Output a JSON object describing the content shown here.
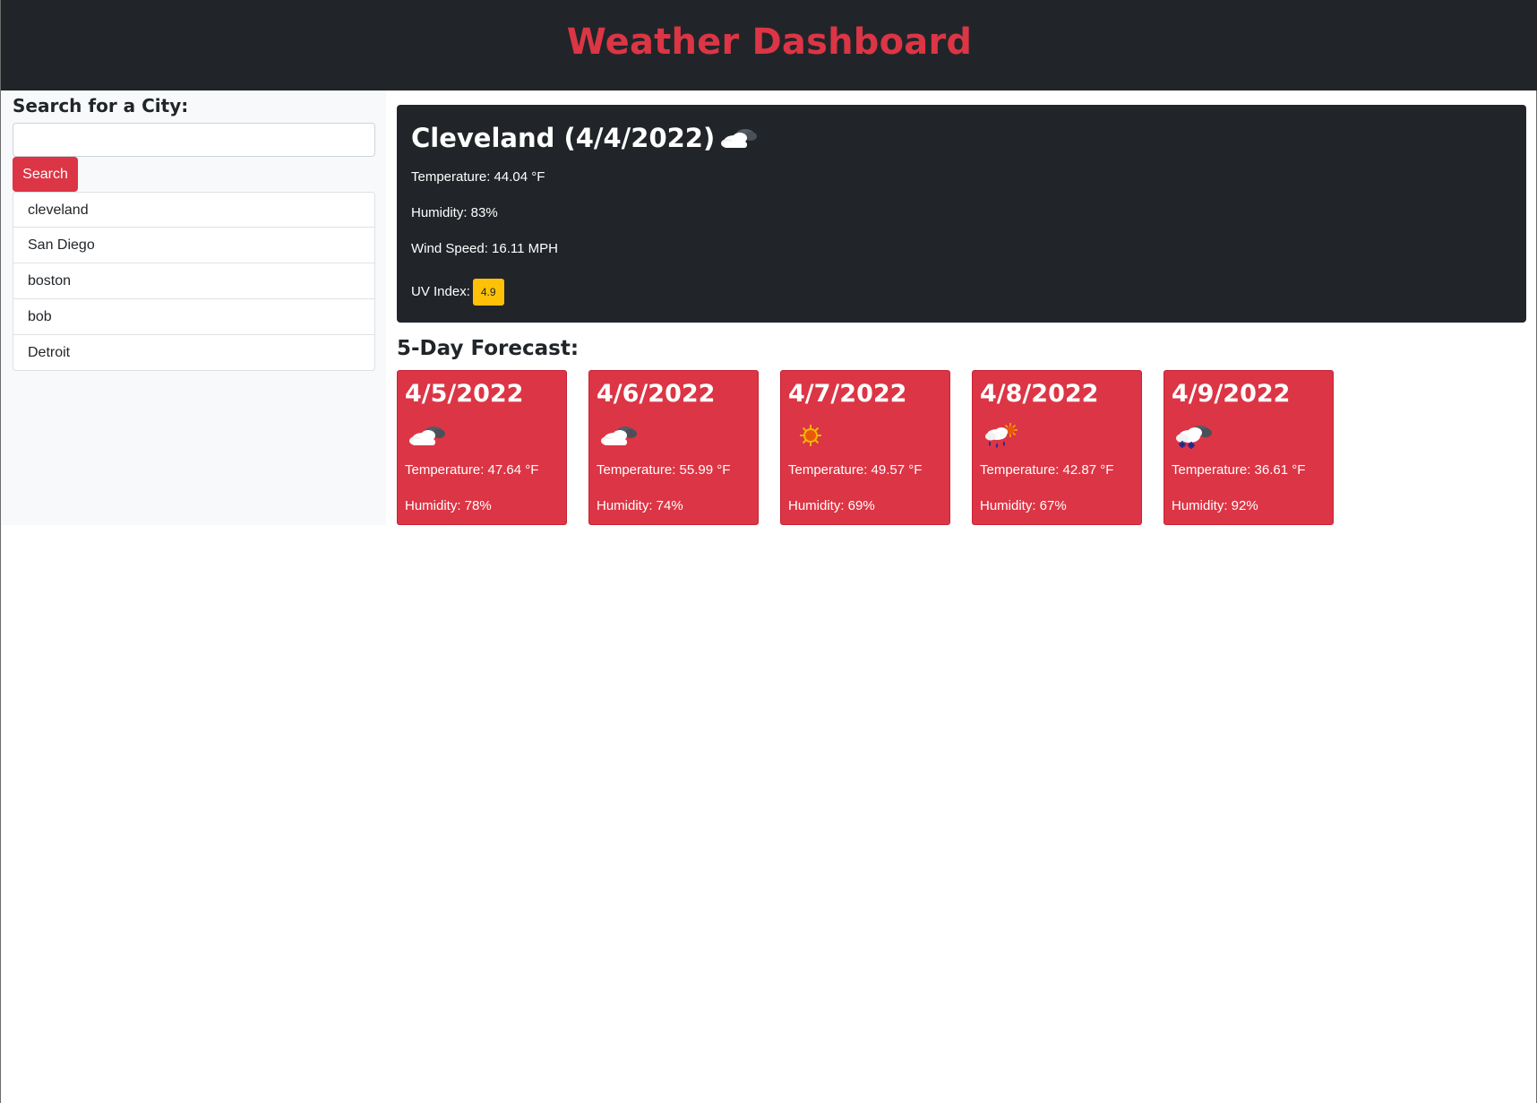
{
  "header": {
    "title": "Weather Dashboard"
  },
  "sidebar": {
    "search_label": "Search for a City:",
    "search_value": "",
    "search_placeholder": "",
    "search_button": "Search",
    "history": [
      "cleveland",
      "San Diego",
      "boston",
      "bob",
      "Detroit"
    ]
  },
  "current": {
    "title": "Cleveland (4/4/2022)",
    "icon": "cloudy-icon",
    "temperature": "Temperature: 44.04 °F",
    "humidity": "Humidity: 83%",
    "wind": "Wind Speed: 16.11 MPH",
    "uv_label": "UV Index:",
    "uv_value": "4.9",
    "uv_color": "#ffc107"
  },
  "forecast": {
    "heading": "5-Day Forecast:",
    "days": [
      {
        "date": "4/5/2022",
        "icon": "cloudy-icon",
        "temperature": "Temperature: 47.64 °F",
        "humidity": "Humidity: 78%"
      },
      {
        "date": "4/6/2022",
        "icon": "cloudy-icon",
        "temperature": "Temperature: 55.99 °F",
        "humidity": "Humidity: 74%"
      },
      {
        "date": "4/7/2022",
        "icon": "sunny-icon",
        "temperature": "Temperature: 49.57 °F",
        "humidity": "Humidity: 69%"
      },
      {
        "date": "4/8/2022",
        "icon": "rain-sun-icon",
        "temperature": "Temperature: 42.87 °F",
        "humidity": "Humidity: 67%"
      },
      {
        "date": "4/9/2022",
        "icon": "snow-icon",
        "temperature": "Temperature: 36.61 °F",
        "humidity": "Humidity: 92%"
      }
    ]
  },
  "colors": {
    "dark": "#212529",
    "accent": "#dc3545",
    "sidebar_bg": "#f8f9fa",
    "uv_moderate": "#ffc107"
  }
}
